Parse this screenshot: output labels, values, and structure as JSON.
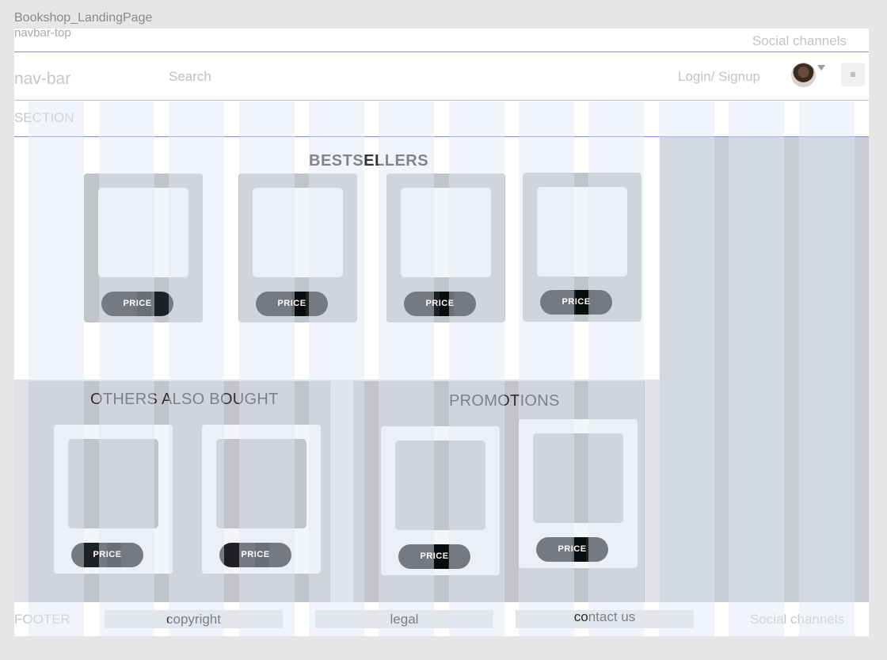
{
  "frame_title": "Bookshop_LandingPage",
  "navbar_top": {
    "label": "navbar-top",
    "social": "Social channels"
  },
  "navbar": {
    "label": "nav-bar",
    "search": "Search",
    "login": "Login/ Signup",
    "menu_icon": "hamburger-icon"
  },
  "section": {
    "label": "SECTION"
  },
  "bestsellers": {
    "title": "BESTSELLERS",
    "items": [
      {
        "price": "PRICE"
      },
      {
        "price": "PRICE"
      },
      {
        "price": "PRICE"
      },
      {
        "price": "PRICE"
      }
    ]
  },
  "others": {
    "title": "OTHERS ALSO BOUGHT",
    "items": [
      {
        "price": "PRICE"
      },
      {
        "price": "PRICE"
      }
    ]
  },
  "promotions": {
    "title": "PROMOTIONS",
    "items": [
      {
        "price": "PRICE"
      },
      {
        "price": "PRICE"
      }
    ]
  },
  "footer": {
    "label": "FOOTER",
    "copyright": "copyright",
    "legal": "legal",
    "contact": "contact us",
    "social": "Social channels"
  },
  "colors": {
    "card_gray": "#c2c4c9",
    "price_pill": "#1e2023",
    "guide_line": "#8b86e0"
  }
}
